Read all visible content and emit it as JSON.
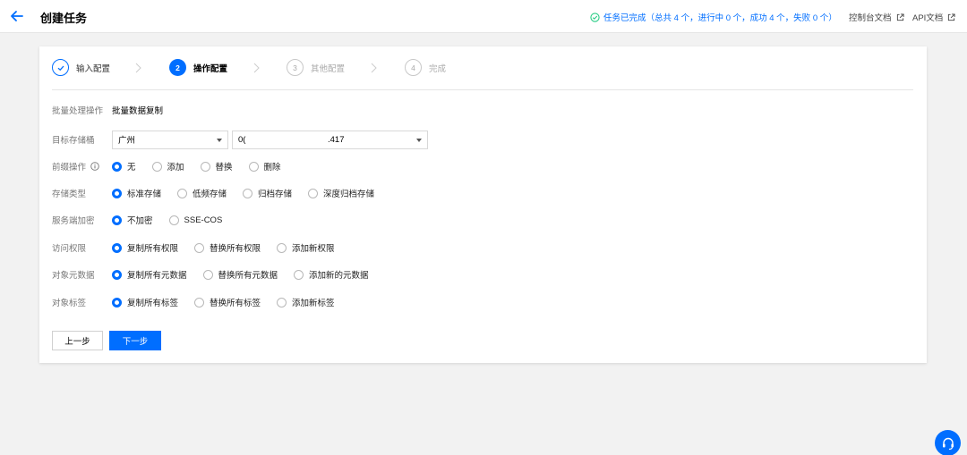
{
  "header": {
    "title": "创建任务",
    "status_text": "任务已完成（总共 4 个，进行中 0 个，成功 4 个，失败 0 个）",
    "console_doc_label": "控制台文档",
    "api_doc_label": "API文档"
  },
  "steps": [
    {
      "num": "",
      "label": "输入配置",
      "state": "done"
    },
    {
      "num": "2",
      "label": "操作配置",
      "state": "active"
    },
    {
      "num": "3",
      "label": "其他配置",
      "state": "todo"
    },
    {
      "num": "4",
      "label": "完成",
      "state": "todo"
    }
  ],
  "form": {
    "operation": {
      "label": "批量处理操作",
      "value": "批量数据复制"
    },
    "target_bucket": {
      "label": "目标存储桶",
      "region": "广州",
      "bucket_prefix": "0(",
      "bucket_suffix": ".417"
    },
    "prefix_op": {
      "label": "前缀操作",
      "options": [
        "无",
        "添加",
        "替换",
        "删除"
      ],
      "selected": 0
    },
    "storage_class": {
      "label": "存储类型",
      "options": [
        "标准存储",
        "低频存储",
        "归档存储",
        "深度归档存储"
      ],
      "selected": 0
    },
    "encryption": {
      "label": "服务端加密",
      "options": [
        "不加密",
        "SSE-COS"
      ],
      "selected": 0
    },
    "acl": {
      "label": "访问权限",
      "options": [
        "复制所有权限",
        "替换所有权限",
        "添加新权限"
      ],
      "selected": 0
    },
    "metadata": {
      "label": "对象元数据",
      "options": [
        "复制所有元数据",
        "替换所有元数据",
        "添加新的元数据"
      ],
      "selected": 0
    },
    "tags": {
      "label": "对象标签",
      "options": [
        "复制所有标签",
        "替换所有标签",
        "添加新标签"
      ],
      "selected": 0
    }
  },
  "buttons": {
    "prev": "上一步",
    "next": "下一步"
  },
  "colors": {
    "accent": "#006eff",
    "success": "#29cc85"
  },
  "icons": {
    "back": "arrow-left-icon",
    "status": "check-circle-icon",
    "external": "external-link-icon",
    "info": "info-icon",
    "help": "headset-icon"
  }
}
